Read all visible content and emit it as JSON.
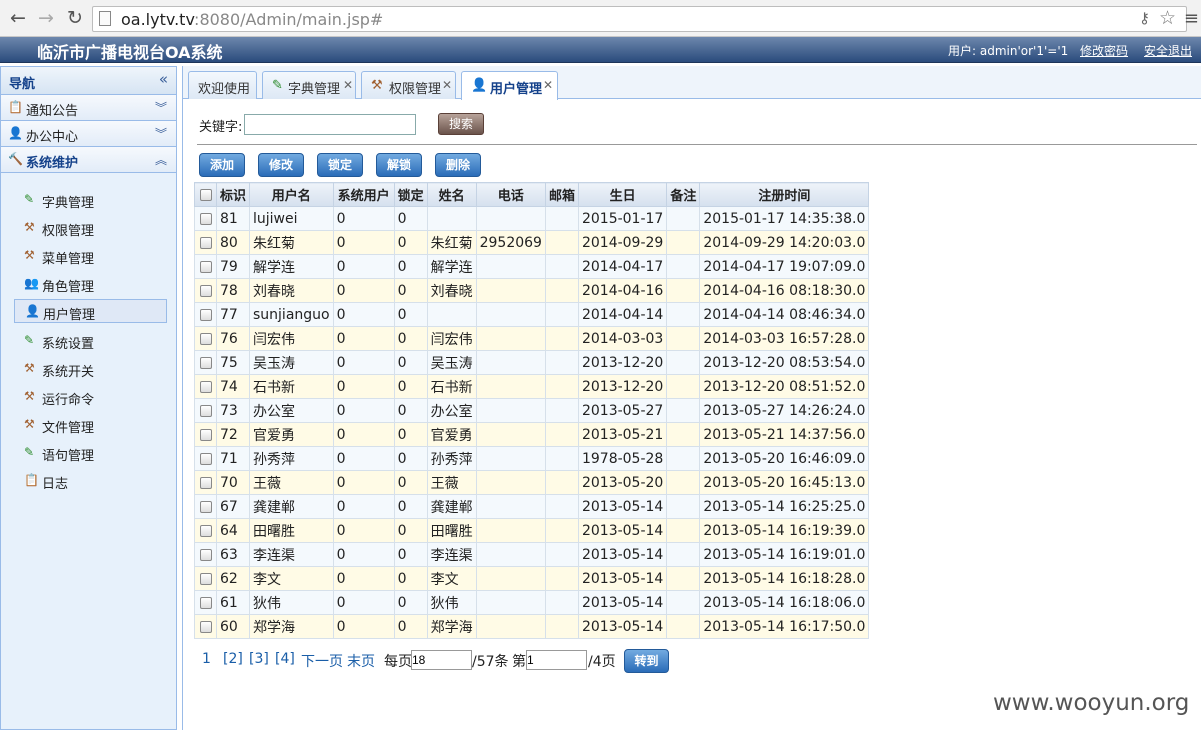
{
  "browser": {
    "url_host": "oa.lytv.tv",
    "url_rest": ":8080/Admin/main.jsp#"
  },
  "header": {
    "title": "临沂市广播电视台OA系统",
    "user": "用户: admin'or'1'='1",
    "change_pwd": "修改密码",
    "logout": "安全退出"
  },
  "sidebar": {
    "title": "导航",
    "sections": [
      {
        "label": "通知公告"
      },
      {
        "label": "办公中心"
      },
      {
        "label": "系统维护"
      }
    ],
    "items": [
      {
        "label": "字典管理"
      },
      {
        "label": "权限管理"
      },
      {
        "label": "菜单管理"
      },
      {
        "label": "角色管理"
      },
      {
        "label": "用户管理"
      },
      {
        "label": "系统设置"
      },
      {
        "label": "系统开关"
      },
      {
        "label": "运行命令"
      },
      {
        "label": "文件管理"
      },
      {
        "label": "语句管理"
      },
      {
        "label": "日志"
      }
    ]
  },
  "tabs": [
    {
      "label": "欢迎使用"
    },
    {
      "label": "字典管理"
    },
    {
      "label": "权限管理"
    },
    {
      "label": "用户管理"
    }
  ],
  "search": {
    "label": "关键字:",
    "value": "",
    "button": "搜索"
  },
  "toolbar": {
    "add": "添加",
    "edit": "修改",
    "lock": "锁定",
    "unlock": "解锁",
    "delete": "删除"
  },
  "table": {
    "columns": [
      "标识",
      "用户名",
      "系统用户",
      "锁定",
      "姓名",
      "电话",
      "邮箱",
      "生日",
      "备注",
      "注册时间"
    ],
    "rows": [
      [
        "81",
        "lujiwei",
        "0",
        "0",
        "",
        "",
        "",
        "2015-01-17",
        "",
        "2015-01-17 14:35:38.0"
      ],
      [
        "80",
        "朱红菊",
        "0",
        "0",
        "朱红菊",
        "2952069",
        "",
        "2014-09-29",
        "",
        "2014-09-29 14:20:03.0"
      ],
      [
        "79",
        "解学连",
        "0",
        "0",
        "解学连",
        "",
        "",
        "2014-04-17",
        "",
        "2014-04-17 19:07:09.0"
      ],
      [
        "78",
        "刘春晓",
        "0",
        "0",
        "刘春晓",
        "",
        "",
        "2014-04-16",
        "",
        "2014-04-16 08:18:30.0"
      ],
      [
        "77",
        "sunjianguo",
        "0",
        "0",
        "",
        "",
        "",
        "2014-04-14",
        "",
        "2014-04-14 08:46:34.0"
      ],
      [
        "76",
        "闫宏伟",
        "0",
        "0",
        "闫宏伟",
        "",
        "",
        "2014-03-03",
        "",
        "2014-03-03 16:57:28.0"
      ],
      [
        "75",
        "吴玉涛",
        "0",
        "0",
        "吴玉涛",
        "",
        "",
        "2013-12-20",
        "",
        "2013-12-20 08:53:54.0"
      ],
      [
        "74",
        "石书新",
        "0",
        "0",
        "石书新",
        "",
        "",
        "2013-12-20",
        "",
        "2013-12-20 08:51:52.0"
      ],
      [
        "73",
        "办公室",
        "0",
        "0",
        "办公室",
        "",
        "",
        "2013-05-27",
        "",
        "2013-05-27 14:26:24.0"
      ],
      [
        "72",
        "官爱勇",
        "0",
        "0",
        "官爱勇",
        "",
        "",
        "2013-05-21",
        "",
        "2013-05-21 14:37:56.0"
      ],
      [
        "71",
        "孙秀萍",
        "0",
        "0",
        "孙秀萍",
        "",
        "",
        "1978-05-28",
        "",
        "2013-05-20 16:46:09.0"
      ],
      [
        "70",
        "王薇",
        "0",
        "0",
        "王薇",
        "",
        "",
        "2013-05-20",
        "",
        "2013-05-20 16:45:13.0"
      ],
      [
        "67",
        "龚建郸",
        "0",
        "0",
        "龚建郸",
        "",
        "",
        "2013-05-14",
        "",
        "2013-05-14 16:25:25.0"
      ],
      [
        "64",
        "田曙胜",
        "0",
        "0",
        "田曙胜",
        "",
        "",
        "2013-05-14",
        "",
        "2013-05-14 16:19:39.0"
      ],
      [
        "63",
        "李连渠",
        "0",
        "0",
        "李连渠",
        "",
        "",
        "2013-05-14",
        "",
        "2013-05-14 16:19:01.0"
      ],
      [
        "62",
        "李文",
        "0",
        "0",
        "李文",
        "",
        "",
        "2013-05-14",
        "",
        "2013-05-14 16:18:28.0"
      ],
      [
        "61",
        "狄伟",
        "0",
        "0",
        "狄伟",
        "",
        "",
        "2013-05-14",
        "",
        "2013-05-14 16:18:06.0"
      ],
      [
        "60",
        "郑学海",
        "0",
        "0",
        "郑学海",
        "",
        "",
        "2013-05-14",
        "",
        "2013-05-14 16:17:50.0"
      ]
    ]
  },
  "pager": {
    "current": "1",
    "pages": [
      "[2]",
      "[3]",
      "[4]"
    ],
    "next": "下一页",
    "last": "末页",
    "per_page_label": "每页",
    "per_page": "18",
    "total": "/57条",
    "page_label": "第",
    "page_value": "1",
    "page_total": "/4页",
    "go": "转到"
  },
  "watermark": "www.wooyun.org"
}
